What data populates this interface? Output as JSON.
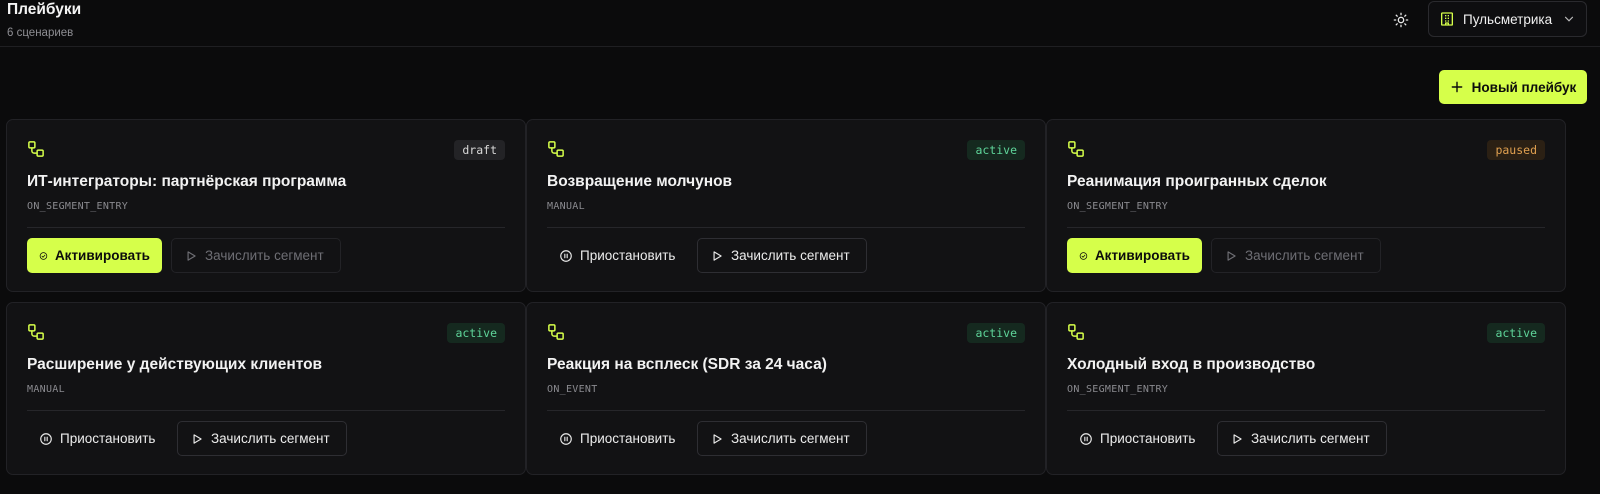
{
  "header": {
    "title": "Плейбуки",
    "subtitle": "6 сценариев",
    "theme_icon": "sun-icon",
    "workspace": {
      "label": "Пульсметрика",
      "icon": "building-icon"
    }
  },
  "toolbar": {
    "new_label": "Новый плейбук"
  },
  "colors": {
    "accent": "#d6ff4a",
    "active": "#5fd59a",
    "paused": "#e0a050",
    "background": "#0b0b0c",
    "card": "#121214"
  },
  "playbooks": [
    {
      "title": "ИТ-интеграторы: партнёрская программа",
      "trigger": "ON_SEGMENT_ENTRY",
      "status": "draft",
      "primary": {
        "label": "Активировать",
        "icon": "check-circle-icon",
        "style": "primary"
      },
      "secondary": {
        "label": "Зачислить сегмент",
        "icon": "play-icon",
        "disabled": true
      }
    },
    {
      "title": "Возвращение молчунов",
      "trigger": "MANUAL",
      "status": "active",
      "primary": {
        "label": "Приостановить",
        "icon": "pause-circle-icon",
        "style": "ghost"
      },
      "secondary": {
        "label": "Зачислить сегмент",
        "icon": "play-icon",
        "disabled": false
      }
    },
    {
      "title": "Реанимация проигранных сделок",
      "trigger": "ON_SEGMENT_ENTRY",
      "status": "paused",
      "primary": {
        "label": "Активировать",
        "icon": "check-circle-icon",
        "style": "primary"
      },
      "secondary": {
        "label": "Зачислить сегмент",
        "icon": "play-icon",
        "disabled": true
      }
    },
    {
      "title": "Расширение у действующих клиентов",
      "trigger": "MANUAL",
      "status": "active",
      "primary": {
        "label": "Приостановить",
        "icon": "pause-circle-icon",
        "style": "ghost"
      },
      "secondary": {
        "label": "Зачислить сегмент",
        "icon": "play-icon",
        "disabled": false
      }
    },
    {
      "title": "Реакция на всплеск (SDR за 24 часа)",
      "trigger": "ON_EVENT",
      "status": "active",
      "primary": {
        "label": "Приостановить",
        "icon": "pause-circle-icon",
        "style": "ghost"
      },
      "secondary": {
        "label": "Зачислить сегмент",
        "icon": "play-icon",
        "disabled": false
      }
    },
    {
      "title": "Холодный вход в производство",
      "trigger": "ON_SEGMENT_ENTRY",
      "status": "active",
      "primary": {
        "label": "Приостановить",
        "icon": "pause-circle-icon",
        "style": "ghost"
      },
      "secondary": {
        "label": "Зачислить сегмент",
        "icon": "play-icon",
        "disabled": false
      }
    }
  ]
}
